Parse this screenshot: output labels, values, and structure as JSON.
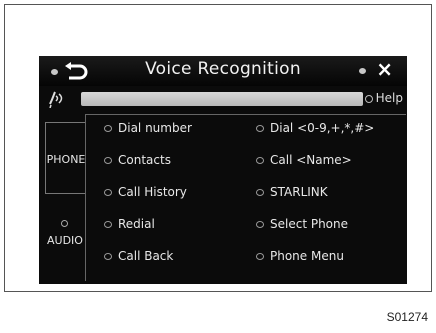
{
  "screen": {
    "title": "Voice Recognition",
    "icons": {
      "back": "return-arrow-icon",
      "close": "close-x-icon",
      "voice": "voice-recognition-icon"
    },
    "close_label": "×",
    "help_label": "Help",
    "tabs": [
      {
        "label": "PHONE",
        "selected": true
      },
      {
        "label": "AUDIO",
        "selected": false
      }
    ],
    "commands": [
      "Dial number",
      "Dial <0-9,+,*,#>",
      "Contacts",
      "Call <Name>",
      "Call History",
      "STARLINK",
      "Redial",
      "Select Phone",
      "Call Back",
      "Phone Menu"
    ]
  },
  "figure_id": "S01274"
}
